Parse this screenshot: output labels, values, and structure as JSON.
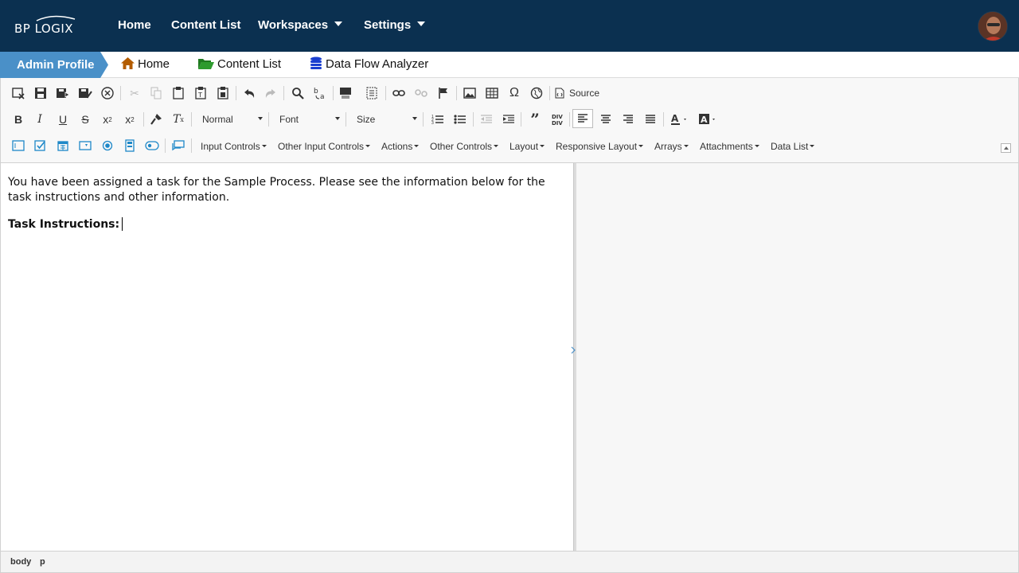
{
  "brand": {
    "logo_text": "BP LOGIX"
  },
  "topnav": {
    "items": [
      {
        "label": "Home"
      },
      {
        "label": "Content List"
      },
      {
        "label": "Workspaces"
      },
      {
        "label": "Settings"
      }
    ]
  },
  "breadcrumb": {
    "active": "Admin Profile",
    "items": [
      {
        "label": "Home",
        "icon": "home-icon",
        "color": "#b35c00"
      },
      {
        "label": "Content List",
        "icon": "folder-open-icon",
        "color": "#2e9b2e"
      },
      {
        "label": "Data Flow Analyzer",
        "icon": "database-icon",
        "color": "#1a3fd0"
      }
    ]
  },
  "toolbar": {
    "source_label": "Source",
    "format_combo": "Normal",
    "font_combo": "Font",
    "size_combo": "Size",
    "menus": [
      "Input Controls",
      "Other Input Controls",
      "Actions",
      "Other Controls",
      "Layout",
      "Responsive Layout",
      "Arrays",
      "Attachments",
      "Data List"
    ]
  },
  "editor": {
    "paragraph1": "You have been assigned a task for the Sample Process. Please see the information below for the task instructions and other information.",
    "paragraph2": "Task Instructions:"
  },
  "statusbar": {
    "path": [
      "body",
      "p"
    ]
  },
  "colors": {
    "nav_bg": "#0b3050",
    "crumb_active_bg": "#4a90c8"
  }
}
